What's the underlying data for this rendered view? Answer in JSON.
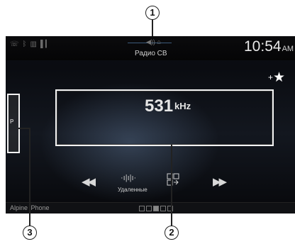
{
  "callouts": {
    "one": "1",
    "two": "2",
    "three": "3"
  },
  "status": {
    "source_label": "Радио СВ",
    "time": "10:54",
    "ampm": "AM"
  },
  "tuner": {
    "frequency": "531",
    "unit": "kHz"
  },
  "preset_tab": {
    "label": "P"
  },
  "favorite": {
    "plus": "+",
    "star": "★"
  },
  "controls": {
    "prev": "◀◀",
    "wave": "·ı|ı|ı·",
    "mode_label": "Удаленные",
    "next": "▶▶"
  },
  "bottom": {
    "device_label": "Alpine iPhone",
    "pages": [
      false,
      false,
      true,
      false,
      false
    ]
  },
  "icons": [
    "phone-icon",
    "bluetooth-icon",
    "battery-icon",
    "signal-icon",
    "mute-icon",
    "prev-track-icon",
    "waveform-icon",
    "list-icon",
    "next-track-icon",
    "star-icon"
  ]
}
